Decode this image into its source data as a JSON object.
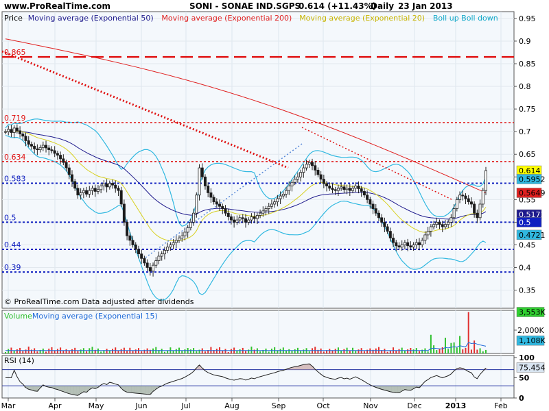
{
  "header": {
    "site": "www.ProRealTime.com",
    "instrument": "SONI - SONAE IND.SGPS",
    "quote": "0.614 (+11.43%)",
    "period": "Daily",
    "date": "23 Jan 2013"
  },
  "copyright": "© ProRealTime.com  Data adjusted after dividends",
  "colors": {
    "candle_up": "#1a1a1a",
    "price_line": "#1a1a1a",
    "ema50": "#1e1a8c",
    "ema200": "#e02020",
    "ema20": "#d8d020",
    "bollinger": "#30b8e0",
    "hlines": "#1020c0",
    "red_levels": "#e01010",
    "volume_up": "#30c030",
    "volume_down": "#e03030",
    "volume_ema": "#1e6ad8",
    "rsi_line": "#202020"
  },
  "chart_data": [
    {
      "type": "candlestick",
      "name": "price-panel",
      "legend": [
        {
          "label": "Price",
          "color": "#000000"
        },
        {
          "label": "Moving average (Exponential 50)",
          "color": "#1e1a8c"
        },
        {
          "label": "Moving average (Exponential 200)",
          "color": "#e02020"
        },
        {
          "label": "Moving average (Exponential 20)",
          "color": "#c8b400"
        },
        {
          "label": "Boll up Boll down",
          "color": "#10a8c8"
        }
      ],
      "x_ticks": [
        "Mar",
        "Apr",
        "May",
        "Jun",
        "Jul",
        "Aug",
        "Sep",
        "Oct",
        "Nov",
        "Dec",
        "2013",
        "Feb"
      ],
      "ylim": [
        0.31,
        0.965
      ],
      "y_ticks": [
        "0.95",
        "0.9",
        "0.85",
        "0.8",
        "0.75",
        "0.7",
        "0.65",
        "0.6",
        "0.55",
        "0.5",
        "0.45",
        "0.4",
        "0.35"
      ],
      "red_levels": [
        {
          "label": "0.865",
          "value": 0.865,
          "dashed": "long"
        },
        {
          "label": "0.719",
          "value": 0.72
        },
        {
          "label": "0.634",
          "value": 0.634
        }
      ],
      "blue_levels": [
        {
          "label": "0.583",
          "value": 0.586
        },
        {
          "label": "0.5",
          "value": 0.5
        },
        {
          "label": "0.44",
          "value": 0.44
        },
        {
          "label": "0.39",
          "value": 0.39
        }
      ],
      "value_tags": [
        {
          "label": "0.614",
          "value": 0.614,
          "bg": "#ffff00"
        },
        {
          "label": "0.5952",
          "value": 0.5952,
          "bg": "#30b8e0"
        },
        {
          "label": "0.5649",
          "value": 0.5649,
          "bg": "#e02020"
        },
        {
          "label": "0.5171",
          "value": 0.5171,
          "bg": "#1e1a8c"
        },
        {
          "label": "0.5",
          "value": 0.5,
          "bg": "#1020c0"
        },
        {
          "label": "0.4721",
          "value": 0.4721,
          "bg": "#30b8e0"
        }
      ],
      "close": [
        0.7,
        0.705,
        0.698,
        0.708,
        0.702,
        0.695,
        0.69,
        0.68,
        0.672,
        0.668,
        0.662,
        0.66,
        0.665,
        0.67,
        0.664,
        0.66,
        0.658,
        0.652,
        0.648,
        0.64,
        0.632,
        0.62,
        0.605,
        0.59,
        0.575,
        0.56,
        0.565,
        0.57,
        0.562,
        0.57,
        0.575,
        0.568,
        0.572,
        0.58,
        0.585,
        0.578,
        0.586,
        0.582,
        0.575,
        0.57,
        0.54,
        0.5,
        0.47,
        0.46,
        0.45,
        0.44,
        0.43,
        0.42,
        0.41,
        0.4,
        0.392,
        0.405,
        0.415,
        0.425,
        0.43,
        0.438,
        0.445,
        0.45,
        0.455,
        0.46,
        0.465,
        0.47,
        0.478,
        0.488,
        0.5,
        0.52,
        0.56,
        0.62,
        0.6,
        0.58,
        0.565,
        0.555,
        0.545,
        0.54,
        0.535,
        0.53,
        0.52,
        0.512,
        0.505,
        0.5,
        0.505,
        0.51,
        0.508,
        0.5,
        0.505,
        0.512,
        0.508,
        0.515,
        0.52,
        0.525,
        0.53,
        0.535,
        0.54,
        0.545,
        0.552,
        0.558,
        0.562,
        0.57,
        0.58,
        0.588,
        0.595,
        0.6,
        0.61,
        0.62,
        0.628,
        0.632,
        0.625,
        0.615,
        0.605,
        0.595,
        0.585,
        0.58,
        0.575,
        0.572,
        0.57,
        0.575,
        0.578,
        0.572,
        0.575,
        0.57,
        0.575,
        0.58,
        0.574,
        0.568,
        0.56,
        0.55,
        0.54,
        0.53,
        0.52,
        0.51,
        0.5,
        0.49,
        0.48,
        0.465,
        0.455,
        0.448,
        0.445,
        0.45,
        0.455,
        0.448,
        0.445,
        0.45,
        0.455,
        0.45,
        0.46,
        0.472,
        0.48,
        0.49,
        0.495,
        0.5,
        0.495,
        0.49,
        0.495,
        0.5,
        0.51,
        0.53,
        0.55,
        0.56,
        0.558,
        0.552,
        0.545,
        0.54,
        0.52,
        0.51,
        0.54,
        0.57,
        0.614
      ]
    },
    {
      "type": "bar",
      "name": "volume-panel",
      "legend": [
        {
          "label": "Volume",
          "color": "#30c030"
        },
        {
          "label": "Moving average (Exponential 15)",
          "color": "#1e6ad8"
        }
      ],
      "ylim": [
        0,
        3700
      ],
      "y_ticks": [
        "2,000K"
      ],
      "value_tags": [
        {
          "label": "3,553K",
          "value": 3553,
          "bg": "#30d030"
        },
        {
          "label": "1,108K",
          "value": 1108,
          "bg": "#30b8e0"
        }
      ],
      "spikes": [
        {
          "index": 160,
          "value": 3553
        },
        {
          "index": 147,
          "value": 1600
        },
        {
          "index": 152,
          "value": 1350
        },
        {
          "index": 157,
          "value": 1500
        },
        {
          "index": 154,
          "value": 900
        },
        {
          "index": 155,
          "value": 950
        },
        {
          "index": 148,
          "value": 700
        },
        {
          "index": 162,
          "value": 1108
        }
      ]
    },
    {
      "type": "line",
      "name": "rsi-panel",
      "legend": [
        {
          "label": "RSI (14)",
          "color": "#000000"
        }
      ],
      "ylim": [
        0,
        105
      ],
      "y_ticks": [
        "100",
        "50",
        "0"
      ],
      "levels": [
        70,
        30
      ],
      "value_tags": [
        {
          "label": "75.454",
          "value": 75.454,
          "bg": "#d8e4f0"
        }
      ]
    }
  ]
}
